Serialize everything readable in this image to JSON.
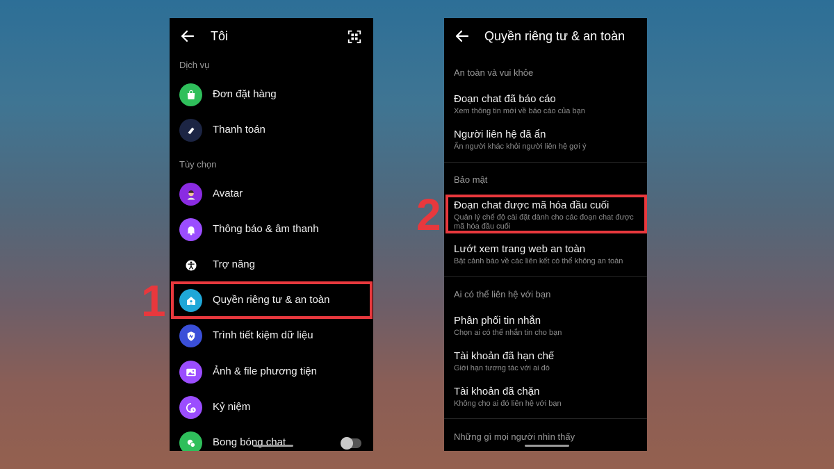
{
  "left_screen": {
    "title": "Tôi",
    "sections": {
      "services": "Dịch vụ",
      "options": "Tùy chọn"
    },
    "items": {
      "orders": "Đơn đặt hàng",
      "payments": "Thanh toán",
      "avatar": "Avatar",
      "notifications": "Thông báo & âm thanh",
      "accessibility": "Trợ năng",
      "privacy": "Quyền riêng tư & an toàn",
      "data_saver": "Trình tiết kiệm dữ liệu",
      "media": "Ảnh & file phương tiện",
      "memories": "Kỷ niệm",
      "chat_heads": "Bong bóng chat"
    },
    "icon_colors": {
      "orders": "#2fbf5b",
      "payments": "#1c2544",
      "avatar": "#8a2be2",
      "notifications": "#9b4dff",
      "accessibility": "#000000",
      "privacy": "#1fa7d8",
      "data_saver": "#3a4fd8",
      "media": "#9b4dff",
      "memories": "#9b4dff",
      "chat_heads": "#2fbf5b"
    },
    "chat_heads_toggle": false
  },
  "right_screen": {
    "title": "Quyền riêng tư & an toàn",
    "sections": {
      "safety": "An toàn và vui khỏe",
      "security": "Bảo mật",
      "contact": "Ai có thể liên hệ với bạn",
      "visibility": "Những gì mọi người nhìn thấy"
    },
    "items": {
      "reported": {
        "title": "Đoạn chat đã báo cáo",
        "subtitle": "Xem thông tin mới về báo cáo của bạn"
      },
      "hidden": {
        "title": "Người liên hệ đã ẩn",
        "subtitle": "Ẩn người khác khỏi người liên hệ gợi ý"
      },
      "e2ee": {
        "title": "Đoạn chat được mã hóa đầu cuối",
        "subtitle": "Quản lý chế độ cài đặt dành cho các đoạn chat được mã hóa đầu cuối"
      },
      "safe_browsing": {
        "title": "Lướt xem trang web an toàn",
        "subtitle": "Bật cảnh báo về các liên kết có thể không an toàn"
      },
      "delivery": {
        "title": "Phân phối tin nhắn",
        "subtitle": "Chọn ai có thể nhắn tin cho bạn"
      },
      "restricted": {
        "title": "Tài khoản đã hạn chế",
        "subtitle": "Giới hạn tương tác với ai đó"
      },
      "blocked": {
        "title": "Tài khoản đã chặn",
        "subtitle": "Không cho ai đó liên hệ với bạn"
      }
    }
  },
  "step_labels": {
    "one": "1",
    "two": "2"
  },
  "colors": {
    "highlight": "#e8383d",
    "background_top": "#2d6f97",
    "background_bottom": "#94604f"
  }
}
